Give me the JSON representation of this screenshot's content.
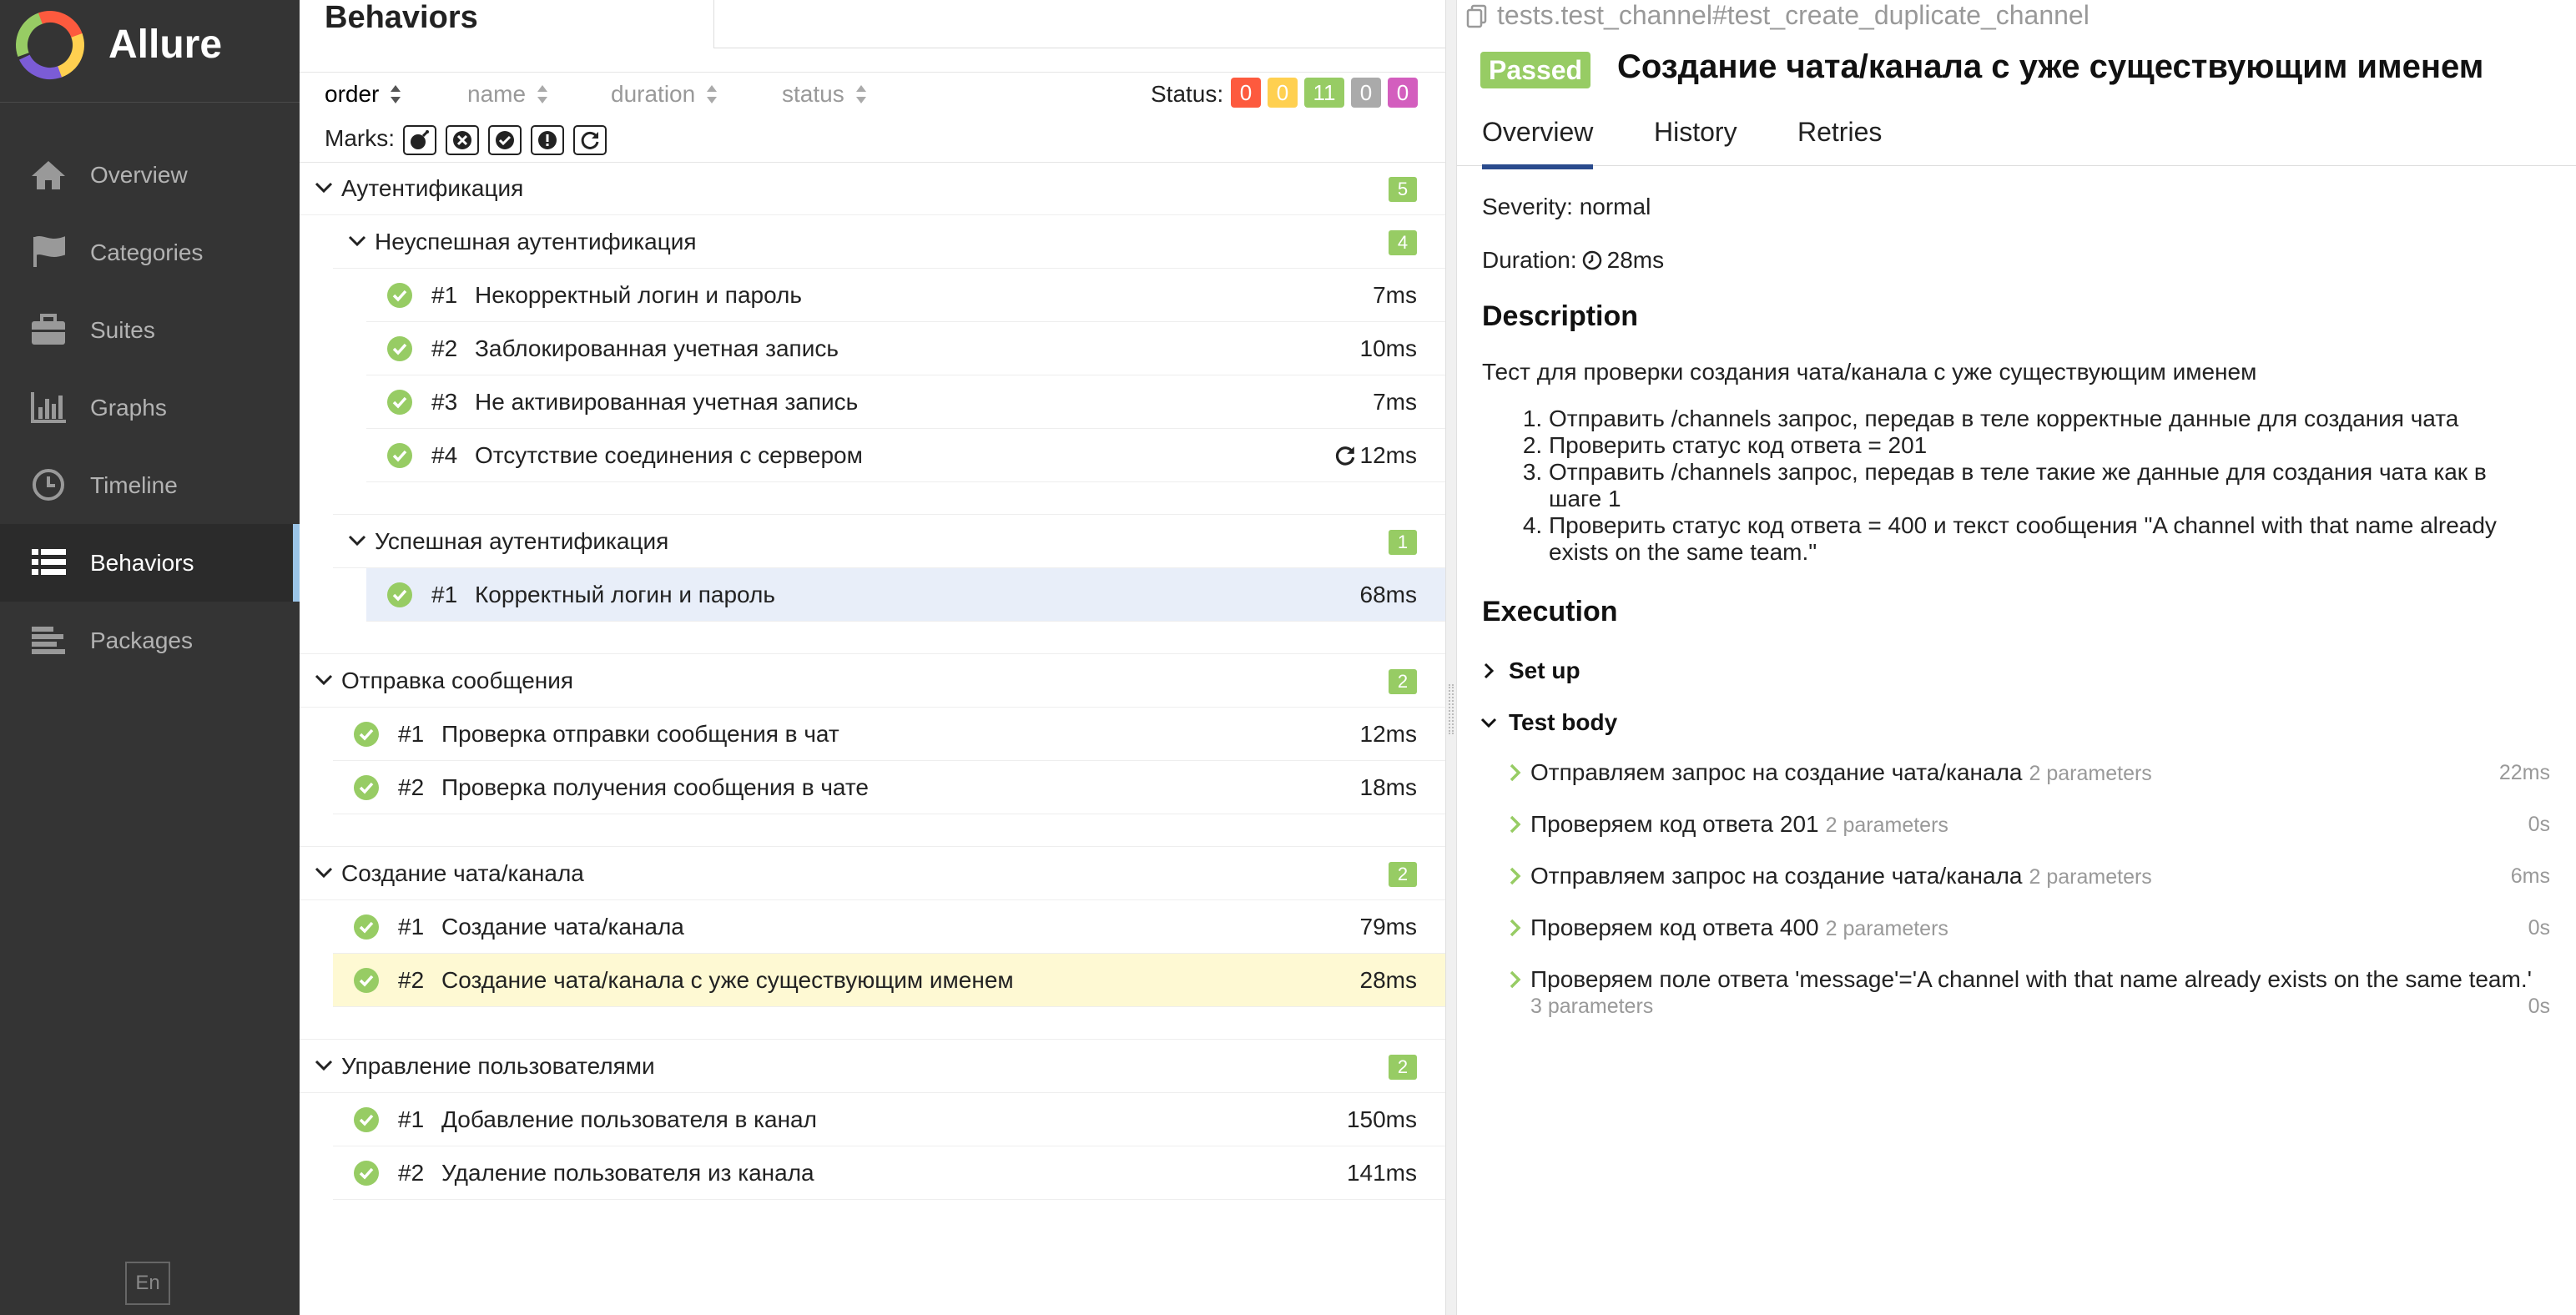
{
  "app": {
    "brand": "Allure",
    "lang_button": "En"
  },
  "colors": {
    "sidebar_bg": "#343434",
    "active_accent": "#9bc5e8",
    "passed": "#97cc64",
    "failed": "#fd5a3e",
    "broken": "#ffd050",
    "skipped": "#aaaaaa",
    "unknown": "#d35ebe",
    "tab_active": "#2a4b8d"
  },
  "nav": {
    "items": [
      {
        "label": "Overview",
        "icon": "home-icon"
      },
      {
        "label": "Categories",
        "icon": "flag-icon"
      },
      {
        "label": "Suites",
        "icon": "briefcase-icon"
      },
      {
        "label": "Graphs",
        "icon": "bar-chart-icon"
      },
      {
        "label": "Timeline",
        "icon": "clock-icon"
      },
      {
        "label": "Behaviors",
        "icon": "list-icon",
        "active": true
      },
      {
        "label": "Packages",
        "icon": "align-left-icon"
      }
    ]
  },
  "tree_pane": {
    "title": "Behaviors",
    "search": {
      "value": "",
      "placeholder": ""
    },
    "sort": {
      "order": "order",
      "name": "name",
      "duration": "duration",
      "status": "status"
    },
    "status_label": "Status:",
    "status_counts": {
      "failed": "0",
      "broken": "0",
      "passed": "11",
      "skipped": "0",
      "unknown": "0"
    },
    "marks_label": "Marks:",
    "groups": [
      {
        "title": "Аутентификация",
        "count": "5",
        "subgroups": [
          {
            "title": "Неуспешная аутентификация",
            "count": "4",
            "tests": [
              {
                "num": "#1",
                "name": "Некорректный логин и пароль",
                "duration": "7ms"
              },
              {
                "num": "#2",
                "name": "Заблокированная учетная запись",
                "duration": "10ms"
              },
              {
                "num": "#3",
                "name": "Не активированная учетная запись",
                "duration": "7ms"
              },
              {
                "num": "#4",
                "name": "Отсутствие соединения с сервером",
                "duration": "12ms",
                "retried": true
              }
            ]
          },
          {
            "title": "Успешная аутентификация",
            "count": "1",
            "tests": [
              {
                "num": "#1",
                "name": "Корректный логин и пароль",
                "duration": "68ms"
              }
            ]
          }
        ]
      },
      {
        "title": "Отправка сообщения",
        "count": "2",
        "tests": [
          {
            "num": "#1",
            "name": "Проверка отправки сообщения в чат",
            "duration": "12ms"
          },
          {
            "num": "#2",
            "name": "Проверка получения сообщения в чате",
            "duration": "18ms"
          }
        ]
      },
      {
        "title": "Создание чата/канала",
        "count": "2",
        "tests": [
          {
            "num": "#1",
            "name": "Создание чата/канала",
            "duration": "79ms"
          },
          {
            "num": "#2",
            "name": "Создание чата/канала с уже существующим именем",
            "duration": "28ms"
          }
        ]
      },
      {
        "title": "Управление пользователями",
        "count": "2",
        "tests": [
          {
            "num": "#1",
            "name": "Добавление пользователя в канал",
            "duration": "150ms"
          },
          {
            "num": "#2",
            "name": "Удаление пользователя из канала",
            "duration": "141ms"
          }
        ]
      }
    ]
  },
  "detail": {
    "path": "tests.test_channel#test_create_duplicate_channel",
    "status": "Passed",
    "title": "Создание чата/канала с уже существующим именем",
    "tabs": [
      "Overview",
      "History",
      "Retries"
    ],
    "severity": "Severity: normal",
    "duration_label": "Duration:",
    "duration": "28ms",
    "description_heading": "Description",
    "description": "Тест для проверки создания чата/канала с уже существующим именем",
    "steps_list": [
      "Отправить /channels запрос, передав в теле корректные данные для создания чата",
      "Проверить статус код ответа = 201",
      "Отправить /channels запрос, передав в теле такие же данные для создания чата как в шаге 1",
      "Проверить статус код ответа = 400 и текст сообщения \"A channel with that name already exists on the same team.\""
    ],
    "execution_heading": "Execution",
    "setup_label": "Set up",
    "body_label": "Test body",
    "steps": [
      {
        "name": "Отправляем запрос на создание чата/канала",
        "params": "2 parameters",
        "duration": "22ms"
      },
      {
        "name": "Проверяем код ответа 201",
        "params": "2 parameters",
        "duration": "0s"
      },
      {
        "name": "Отправляем запрос на создание чата/канала",
        "params": "2 parameters",
        "duration": "6ms"
      },
      {
        "name": "Проверяем код ответа 400",
        "params": "2 parameters",
        "duration": "0s"
      },
      {
        "name": "Проверяем поле ответа 'message'='A channel with that name already exists on the same team.'",
        "params": "3 parameters",
        "duration": "0s"
      }
    ]
  }
}
